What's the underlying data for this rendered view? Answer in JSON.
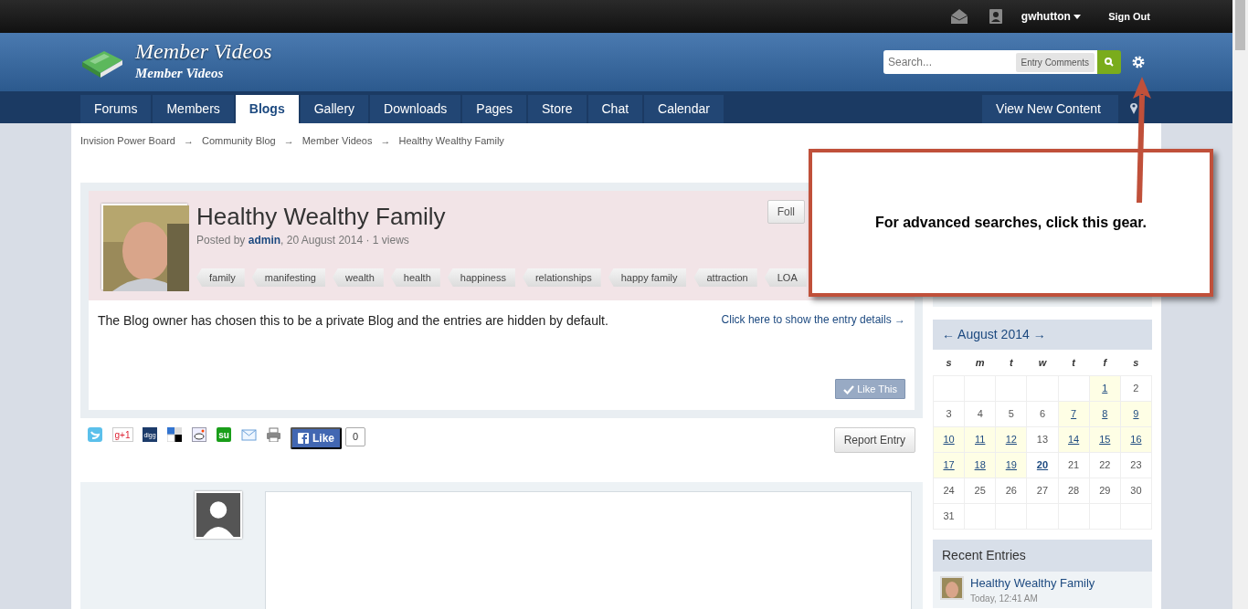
{
  "top_bar": {
    "username": "gwhutton",
    "sign_out": "Sign Out"
  },
  "header": {
    "title": "Member Videos",
    "subtitle": "Member Videos",
    "search": {
      "placeholder": "Search...",
      "scope": "Entry Comments"
    }
  },
  "nav": {
    "tabs": [
      {
        "label": "Forums",
        "selected": false
      },
      {
        "label": "Members",
        "selected": false
      },
      {
        "label": "Blogs",
        "selected": true
      },
      {
        "label": "Gallery",
        "selected": false
      },
      {
        "label": "Downloads",
        "selected": false
      },
      {
        "label": "Pages",
        "selected": false
      },
      {
        "label": "Store",
        "selected": false
      },
      {
        "label": "Chat",
        "selected": false
      },
      {
        "label": "Calendar",
        "selected": false
      }
    ],
    "view_new_content": "View New Content"
  },
  "breadcrumb": {
    "separator": "→",
    "items": [
      "Invision Power Board",
      "Community Blog",
      "Member Videos",
      "Healthy Wealthy Family"
    ]
  },
  "entry": {
    "title": "Healthy Wealthy Family",
    "posted_prefix": "Posted by ",
    "author": "admin",
    "posted_suffix": ", 20 August 2014 · 1 views",
    "follow_button": "Foll",
    "tags": [
      "family",
      "manifesting",
      "wealth",
      "health",
      "happiness",
      "relationships",
      "happy family",
      "attraction",
      "LOA"
    ],
    "notice": "The Blog owner has chosen this to be a private Blog and the entries are hidden by default.",
    "show_details_link": "Click here to show the entry details →",
    "like_button": "Like This"
  },
  "share": {
    "icons": [
      {
        "kind": "twitter"
      },
      {
        "kind": "gplus",
        "label": "g+1"
      },
      {
        "kind": "digg",
        "label": "digg"
      },
      {
        "kind": "delicious"
      },
      {
        "kind": "reddit"
      },
      {
        "kind": "stumble",
        "label": "su"
      },
      {
        "kind": "email"
      },
      {
        "kind": "print"
      }
    ],
    "facebook_like": "Like",
    "like_count": "0",
    "report_button": "Report Entry"
  },
  "sidebar": {
    "calendar": {
      "prev": "←",
      "title": "August 2014",
      "next": "→",
      "weekdays": [
        "s",
        "m",
        "t",
        "w",
        "t",
        "f",
        "s"
      ],
      "weeks": [
        {
          "kind": "leading_blanks",
          "days": [
            {
              "day": "1",
              "has_entry": true,
              "today": false
            },
            {
              "day": "2",
              "has_entry": false,
              "today": false
            }
          ]
        },
        {
          "kind": "full",
          "days": [
            {
              "day": "3",
              "has_entry": false,
              "today": false
            },
            {
              "day": "4",
              "has_entry": false,
              "today": false
            },
            {
              "day": "5",
              "has_entry": false,
              "today": false
            },
            {
              "day": "6",
              "has_entry": false,
              "today": false
            },
            {
              "day": "7",
              "has_entry": true,
              "today": false
            },
            {
              "day": "8",
              "has_entry": true,
              "today": false
            },
            {
              "day": "9",
              "has_entry": true,
              "today": false
            }
          ]
        },
        {
          "kind": "full",
          "days": [
            {
              "day": "10",
              "has_entry": true,
              "today": false
            },
            {
              "day": "11",
              "has_entry": true,
              "today": false
            },
            {
              "day": "12",
              "has_entry": true,
              "today": false
            },
            {
              "day": "13",
              "has_entry": false,
              "today": false
            },
            {
              "day": "14",
              "has_entry": true,
              "today": false
            },
            {
              "day": "15",
              "has_entry": true,
              "today": false
            },
            {
              "day": "16",
              "has_entry": true,
              "today": false
            }
          ]
        },
        {
          "kind": "full",
          "days": [
            {
              "day": "17",
              "has_entry": true,
              "today": false
            },
            {
              "day": "18",
              "has_entry": true,
              "today": false
            },
            {
              "day": "19",
              "has_entry": true,
              "today": false
            },
            {
              "day": "20",
              "has_entry": false,
              "today": true
            },
            {
              "day": "21",
              "has_entry": false,
              "today": false
            },
            {
              "day": "22",
              "has_entry": false,
              "today": false
            },
            {
              "day": "23",
              "has_entry": false,
              "today": false
            }
          ]
        },
        {
          "kind": "full",
          "days": [
            {
              "day": "24",
              "has_entry": false,
              "today": false
            },
            {
              "day": "25",
              "has_entry": false,
              "today": false
            },
            {
              "day": "26",
              "has_entry": false,
              "today": false
            },
            {
              "day": "27",
              "has_entry": false,
              "today": false
            },
            {
              "day": "28",
              "has_entry": false,
              "today": false
            },
            {
              "day": "29",
              "has_entry": false,
              "today": false
            },
            {
              "day": "30",
              "has_entry": false,
              "today": false
            }
          ]
        },
        {
          "kind": "trailing_blanks",
          "days": [
            {
              "day": "31",
              "has_entry": false,
              "today": false
            }
          ]
        }
      ]
    },
    "recent_entries": {
      "title": "Recent Entries",
      "items": [
        {
          "title": "Healthy Wealthy Family",
          "time": "Today, 12:41 AM"
        }
      ]
    }
  },
  "callout": {
    "text": "For advanced searches, click this gear."
  }
}
